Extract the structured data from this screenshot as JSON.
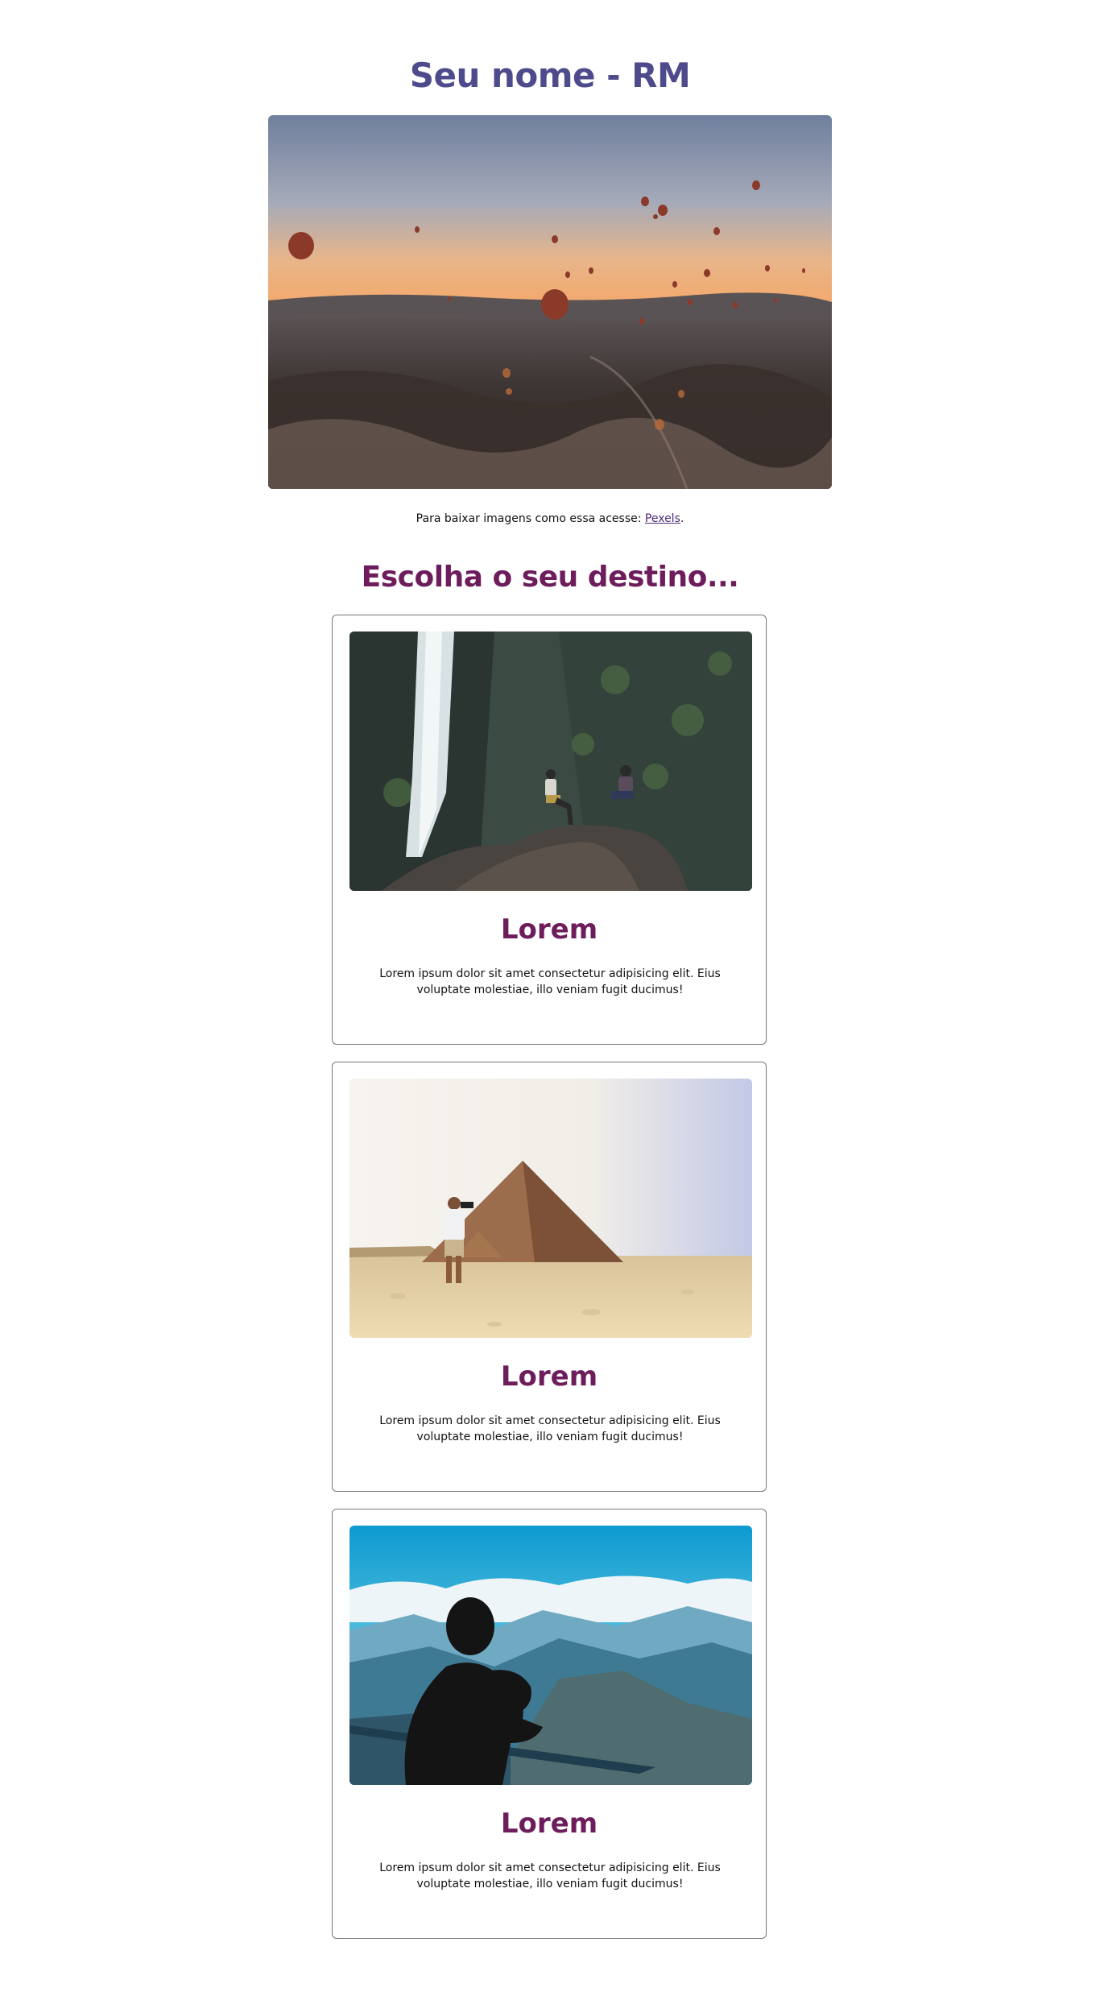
{
  "header": {
    "title": "Seu nome - RM"
  },
  "hero": {
    "image_name": "hot-air-balloons-landscape",
    "caption_prefix": "Para baixar imagens como essa acesse: ",
    "caption_link": "Pexels",
    "caption_suffix": "."
  },
  "destinations": {
    "title": "Escolha o seu destino...",
    "cards": [
      {
        "image_name": "waterfall-travelers",
        "title": "Lorem",
        "text": "Lorem ipsum dolor sit amet consectetur adipisicing elit. Eius voluptate molestiae, illo veniam fugit ducimus!"
      },
      {
        "image_name": "pyramids-photographer",
        "title": "Lorem",
        "text": "Lorem ipsum dolor sit amet consectetur adipisicing elit. Eius voluptate molestiae, illo veniam fugit ducimus!"
      },
      {
        "image_name": "mountain-view-silhouette",
        "title": "Lorem",
        "text": "Lorem ipsum dolor sit amet consectetur adipisicing elit. Eius voluptate molestiae, illo veniam fugit ducimus!"
      }
    ]
  },
  "colors": {
    "title": "#4e4b8c",
    "accent": "#6e1d5c",
    "link": "#4b2a7a"
  }
}
